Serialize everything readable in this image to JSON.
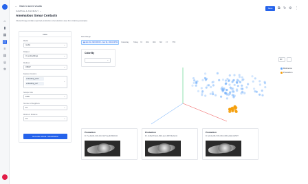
{
  "rail": {
    "icons": [
      "home-icon",
      "bookmark-icon",
      "grid-icon",
      "layers-icon",
      "list-icon",
      "document-icon",
      "globe-icon",
      "settings-icon"
    ]
  },
  "header": {
    "back_label": "Back to saved visuals",
    "breadcrumb": "SAMPLE-4-ANOMALY",
    "title": "Anomalous Sonar Contacts",
    "subtitle": "Cluster/Image similar exported production of production area from training examples",
    "save_label": "Save"
  },
  "config": {
    "tab_label": "Data",
    "fields": [
      {
        "label": "Model",
        "value": "model"
      },
      {
        "label": "Dataset",
        "value": "UI_embeddings"
      },
      {
        "label": "Reducer",
        "value": "UMAP"
      },
      {
        "label": "Feature Columns",
        "chips": [
          "embedding_abcd",
          "embedding_def"
        ]
      },
      {
        "label": "Sample Size",
        "value": "1000"
      },
      {
        "label": "Number of Neighbors",
        "value": "15"
      },
      {
        "label": "Minimum Distance",
        "value": "0.1"
      }
    ],
    "generate_label": "Generate Visual / Visualization"
  },
  "date_range": {
    "label": "Date Range",
    "value": "Jan 01, 2024 00:00 - Jan 31, 2024 23:59",
    "quick": [
      "Yesterday",
      "Today",
      "7d",
      "30d",
      "90d",
      "6M",
      "1Y",
      "YTD"
    ]
  },
  "color_by": {
    "label": "Color By"
  },
  "view_select": "3D",
  "legend": [
    {
      "name": "Reference",
      "color": "#60a5fa"
    },
    {
      "name": "Production",
      "color": "#f59e0b"
    }
  ],
  "cards": [
    {
      "title": "Production",
      "caption": "ID: 7ee3a0d4-b1f2-4c10-9d73-ae4bb5f0d102"
    },
    {
      "title": "Production",
      "caption": "ID: c2d9e3ff-5a41-46b0-a1cd-05f7b9a3e611"
    },
    {
      "title": "Production",
      "caption": "ID: a1b4e2d8-7c63-4f1b-bb86-e0a9c41d5f27"
    }
  ]
}
